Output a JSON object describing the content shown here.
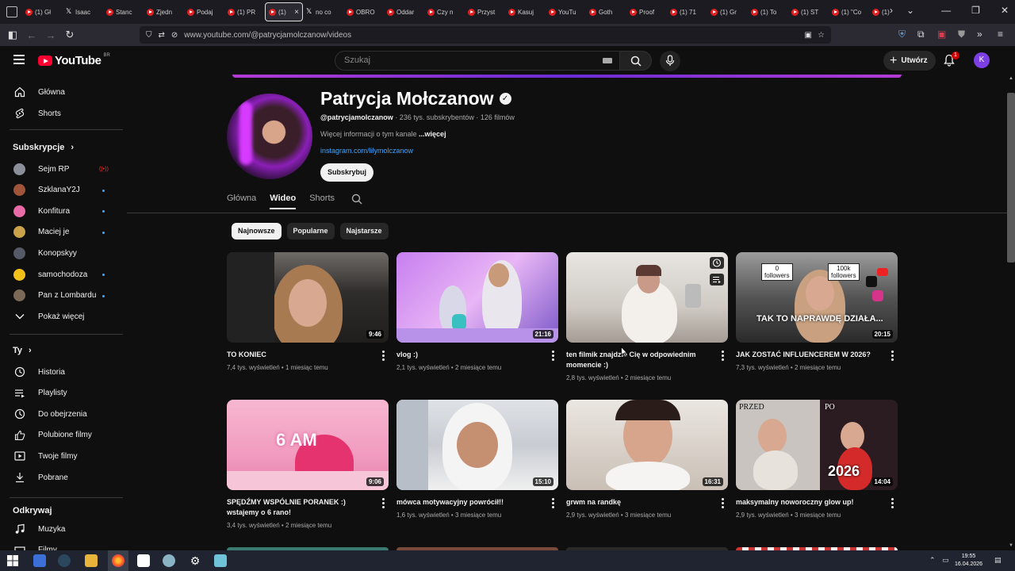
{
  "browser": {
    "tabs": [
      {
        "label": "(1) Gł",
        "icon": "youtube"
      },
      {
        "label": "Isaac",
        "icon": "x"
      },
      {
        "label": "Stanc",
        "icon": "youtube"
      },
      {
        "label": "Zjedn",
        "icon": "youtube"
      },
      {
        "label": "Podaj",
        "icon": "youtube"
      },
      {
        "label": "(1) PR",
        "icon": "youtube"
      },
      {
        "label": "(1)",
        "icon": "youtube",
        "active": true
      },
      {
        "label": "no co",
        "icon": "x"
      },
      {
        "label": "OBRO",
        "icon": "youtube"
      },
      {
        "label": "Oddar",
        "icon": "youtube"
      },
      {
        "label": "Czy n",
        "icon": "youtube"
      },
      {
        "label": "Przyst",
        "icon": "youtube"
      },
      {
        "label": "Kasuj",
        "icon": "youtube"
      },
      {
        "label": "YouTu",
        "icon": "youtube"
      },
      {
        "label": "Goth",
        "icon": "youtube"
      },
      {
        "label": "Proof",
        "icon": "youtube"
      },
      {
        "label": "(1) 71",
        "icon": "youtube"
      },
      {
        "label": "(1) Gr",
        "icon": "youtube"
      },
      {
        "label": "(1) To",
        "icon": "youtube"
      },
      {
        "label": "(1) ST",
        "icon": "youtube"
      },
      {
        "label": "(1) \"Co",
        "icon": "youtube"
      },
      {
        "label": "(1)",
        "icon": "youtube"
      }
    ],
    "active_tab_close": "×",
    "url": "www.youtube.com/@patrycjamolczanow/videos"
  },
  "youtube": {
    "logo_text": "YouTube",
    "country_code": "BR",
    "search_placeholder": "Szukaj",
    "create_label": "Utwórz",
    "notification_count": "1",
    "account_initial": "K"
  },
  "sidebar": {
    "main": [
      {
        "label": "Główna",
        "icon": "home-icon"
      },
      {
        "label": "Shorts",
        "icon": "shorts-icon"
      }
    ],
    "subscriptions_heading": "Subskrypcje",
    "subscriptions": [
      {
        "label": "Sejm RP",
        "status": "live",
        "color": "#8a8f99"
      },
      {
        "label": "SzklanaY2J",
        "status": "new",
        "color": "#a0553a"
      },
      {
        "label": "Konfitura",
        "status": "new",
        "color": "#e86aa6"
      },
      {
        "label": "Maciej je",
        "status": "new",
        "color": "#c9a24a"
      },
      {
        "label": "Konopskyy",
        "status": "none",
        "color": "#555a66"
      },
      {
        "label": "samochodoza",
        "status": "new",
        "color": "#f2c21b"
      },
      {
        "label": "Pan z Lombardu",
        "status": "new",
        "color": "#7a6a55"
      }
    ],
    "live_marker": "((•))",
    "show_more": "Pokaż więcej",
    "you_heading": "Ty",
    "you_items": [
      {
        "label": "Historia",
        "icon": "history-icon"
      },
      {
        "label": "Playlisty",
        "icon": "playlists-icon"
      },
      {
        "label": "Do obejrzenia",
        "icon": "watch-later-icon"
      },
      {
        "label": "Polubione filmy",
        "icon": "liked-icon"
      },
      {
        "label": "Twoje filmy",
        "icon": "your-videos-icon"
      },
      {
        "label": "Pobrane",
        "icon": "downloads-icon"
      }
    ],
    "explore_heading": "Odkrywaj",
    "explore_items": [
      {
        "label": "Muzyka",
        "icon": "music-icon"
      },
      {
        "label": "Filmy",
        "icon": "movies-icon"
      }
    ]
  },
  "channel": {
    "name": "Patrycja Mołczanow",
    "handle": "@patrycjamolczanow",
    "stats": " · 236 tys. subskrybentów · 126 filmów",
    "description": "Więcej informacji o tym kanale ",
    "more": "...więcej",
    "link": "instagram.com/lilymolczanow",
    "subscribe": "Subskrybuj",
    "tabs": [
      "Główna",
      "Wideo",
      "Shorts"
    ],
    "active_tab": "Wideo",
    "chips": [
      "Najnowsze",
      "Popularne",
      "Najstarsze"
    ],
    "active_chip": "Najnowsze"
  },
  "videos": [
    {
      "title": "TO KONIEC",
      "views": "7,4 tys. wyświetleń",
      "age": "1 miesiąc temu",
      "duration": "9:46"
    },
    {
      "title": "vlog :)",
      "views": "2,1 tys. wyświetleń",
      "age": "2 miesiące temu",
      "duration": "21:16"
    },
    {
      "title": "ten filmik znajdzie Cię w odpowiednim momencie :)",
      "views": "2,8 tys. wyświetleń",
      "age": "2 miesiące temu",
      "duration": ""
    },
    {
      "title": "JAK ZOSTAĆ INFLUENCEREM W 2026?",
      "views": "7,3 tys. wyświetleń",
      "age": "2 miesiące temu",
      "duration": "20:15"
    },
    {
      "title": "SPĘDŹMY WSPÓLNIE PORANEK :) wstajemy o 6 rano!",
      "views": "3,4 tys. wyświetleń",
      "age": "2 miesiące temu",
      "duration": "9:06"
    },
    {
      "title": "mówca motywacyjny powrócił!!",
      "views": "1,6 tys. wyświetleń",
      "age": "3 miesiące temu",
      "duration": "15:10"
    },
    {
      "title": "grwm na randkę",
      "views": "2,9 tys. wyświetleń",
      "age": "3 miesiące temu",
      "duration": "16:31"
    },
    {
      "title": "maksymalny noworoczny glow up!",
      "views": "2,9 tys. wyświetleń",
      "age": "3 miesiące temu",
      "duration": "14:04"
    }
  ],
  "meta_separator": " • ",
  "thumbnail_text": {
    "v4_zero": "0",
    "v4_followers_a": "followers",
    "v4_hundredk": "100k",
    "v4_followers_b": "followers",
    "v4_caption": "TAK TO NAPRAWDĘ DZIAŁA...",
    "v5_time": "6 AM",
    "v8_before": "PRZED",
    "v8_after": "PO",
    "v8_year": "2026"
  },
  "taskbar": {
    "time": "19:55",
    "date": "16.04.2026"
  }
}
